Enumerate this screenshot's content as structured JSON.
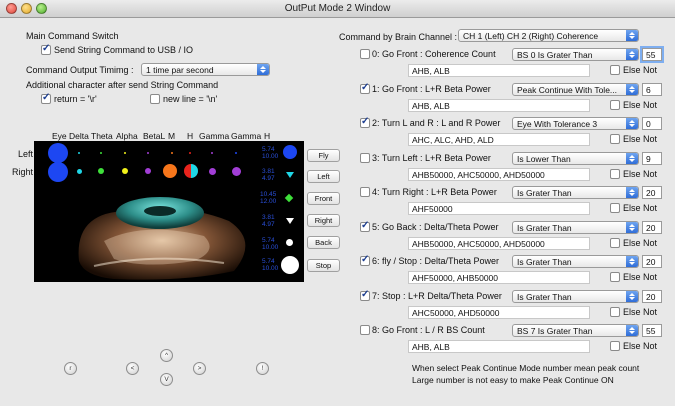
{
  "window": {
    "title": "OutPut Mode 2 Window"
  },
  "left": {
    "main_switch_label": "Main Command Switch",
    "send_usb_label": "Send String Command to USB / IO",
    "send_usb_checked": true,
    "timing_label": "Command Output Timimg :",
    "timing_value": "1 time par second",
    "additional_label": "Additional character after send String Command",
    "return_label": "return =  '\\r'",
    "return_checked": true,
    "newline_label": "new line =  '\\n'",
    "newline_checked": false
  },
  "brain": {
    "headers": [
      "Eye",
      "Delta",
      "Theta",
      "Alpha",
      "BetaL",
      "M",
      "H",
      "Gamma",
      "Gamma",
      "H"
    ],
    "row_labels": [
      "Left",
      "Right"
    ],
    "meter_values": [
      [
        "5.74",
        "10.00"
      ],
      [
        "3.81",
        "4.97"
      ],
      [
        "10.45",
        "12.00"
      ],
      [
        "3.81",
        "4.97"
      ],
      [
        "5.74",
        "10.00"
      ],
      [
        "5.74",
        "10.00"
      ]
    ],
    "colors": {
      "blue": "#1d47f2",
      "orange": "#f7761b",
      "red": "#e8231c",
      "purple": "#a23ed6",
      "green": "#3ee03a",
      "yellow": "#f2f21a",
      "cyan": "#1fd6e6",
      "white": "#ffffff"
    }
  },
  "side_buttons": [
    "Fly",
    "Left",
    "Front",
    "Right",
    "Back",
    "Stop"
  ],
  "bottom_buttons": [
    "r",
    "<",
    "^",
    "V",
    ">",
    "!"
  ],
  "right": {
    "channel_label": "Command by Brain Channel :",
    "channel_value": "CH 1 (Left) CH 2 (Right) Coherence",
    "else_not_label": "Else Not",
    "commands": [
      {
        "label": "0: Go Front : Coherence Count",
        "checked": false,
        "mode": "BS 0 Is Grater Than",
        "value": "55",
        "channels": "AHB, ALB",
        "else_not": false
      },
      {
        "label": "1: Go Front : L+R Beta Power",
        "checked": true,
        "mode": "Peak Continue With Tole...",
        "value": "6",
        "channels": "AHB, ALB",
        "else_not": false
      },
      {
        "label": "2: Turn L and R : L and R Power",
        "checked": true,
        "mode": "Eye With Tolerance 3",
        "value": "0",
        "channels": "AHC, ALC, AHD, ALD",
        "else_not": false
      },
      {
        "label": "3: Turn Left : L+R Beta Power",
        "checked": false,
        "mode": "Is Lower Than",
        "value": "9",
        "channels": "AHB50000, AHC50000, AHD50000",
        "else_not": false
      },
      {
        "label": "4: Turn Right : L+R Beta Power",
        "checked": false,
        "mode": "Is Grater Than",
        "value": "20",
        "channels": "AHF50000",
        "else_not": false
      },
      {
        "label": "5: Go Back : Delta/Theta Power",
        "checked": true,
        "mode": "Is Grater Than",
        "value": "20",
        "channels": "AHB50000, AHC50000, AHD50000",
        "else_not": false
      },
      {
        "label": "6: fly / Stop : Delta/Theta Power",
        "checked": true,
        "mode": "Is Grater Than",
        "value": "20",
        "channels": "AHF50000, AHB50000",
        "else_not": false
      },
      {
        "label": "7: Stop : L+R  Delta/Theta Power",
        "checked": true,
        "mode": "Is Grater Than",
        "value": "20",
        "channels": "AHC50000, AHD50000",
        "else_not": false
      },
      {
        "label": "8: Go Front : L / R BS Count",
        "checked": false,
        "mode": "BS 7 Is Grater Than",
        "value": "55",
        "channels": "AHB, ALB",
        "else_not": false
      }
    ],
    "note_line1": "When select Peak Continue Mode number mean peak count",
    "note_line2": "Large number is not easy to make Peak Continue ON"
  }
}
